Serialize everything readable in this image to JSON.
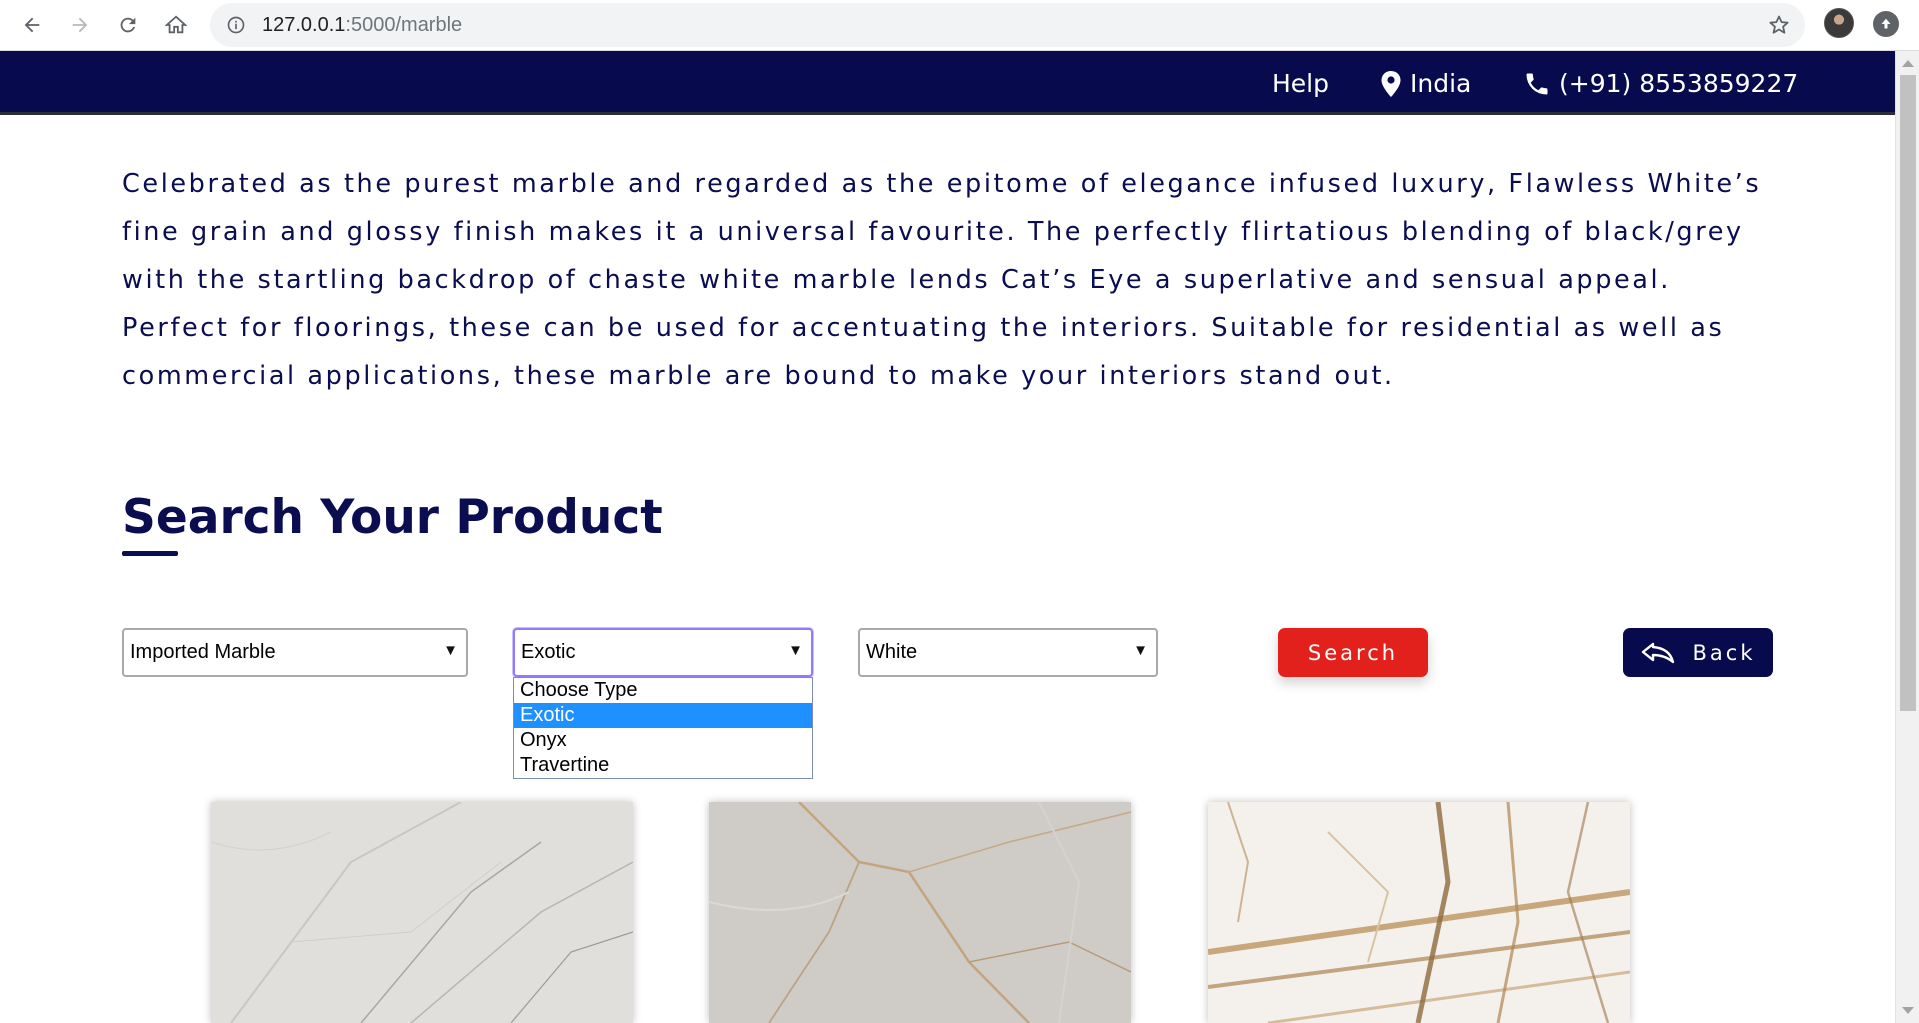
{
  "browser": {
    "url_host": "127.0.0.1",
    "url_path": ":5000/marble"
  },
  "topbar": {
    "help": "Help",
    "location": "India",
    "phone": "(+91) 8553859227",
    "background_color": "#070b4d"
  },
  "intro_text": "Celebrated as the purest marble and regarded as the epitome of elegance infused luxury, Flawless White’s fine grain and glossy finish makes it a universal favourite. The perfectly flirtatious blending of black/grey with the startling backdrop of chaste white marble lends Cat’s Eye a superlative and sensual appeal. Perfect for floorings, these can be used for accentuating the interiors. Suitable for residential as well as commercial applications, these marble are bound to make your interiors stand out.",
  "search": {
    "title": "Search Your Product",
    "category_select": "Imported Marble",
    "type_select": "Exotic",
    "color_select": "White",
    "type_options": [
      "Choose Type",
      "Exotic",
      "Onyx",
      "Travertine"
    ],
    "type_selected_index": 1,
    "search_label": "Search",
    "back_label": "Back",
    "search_color": "#e3211c"
  },
  "products": [
    {
      "icon": "marble-tile-image"
    },
    {
      "icon": "marble-tile-image"
    },
    {
      "icon": "marble-tile-image"
    }
  ]
}
